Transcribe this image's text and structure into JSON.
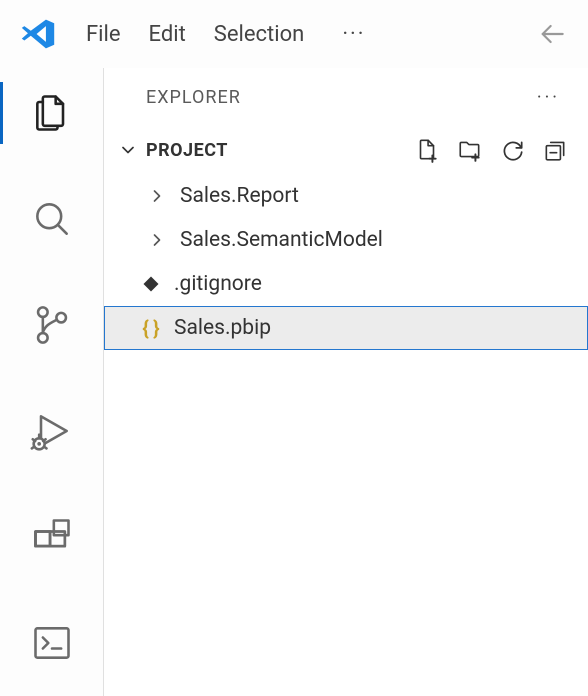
{
  "menu": {
    "file": "File",
    "edit": "Edit",
    "selection": "Selection",
    "more": "···"
  },
  "sidebar": {
    "title": "EXPLORER",
    "more": "···",
    "section": "PROJECT",
    "items": [
      {
        "label": "Sales.Report"
      },
      {
        "label": "Sales.SemanticModel"
      },
      {
        "label": ".gitignore"
      },
      {
        "label": "Sales.pbip"
      }
    ]
  }
}
